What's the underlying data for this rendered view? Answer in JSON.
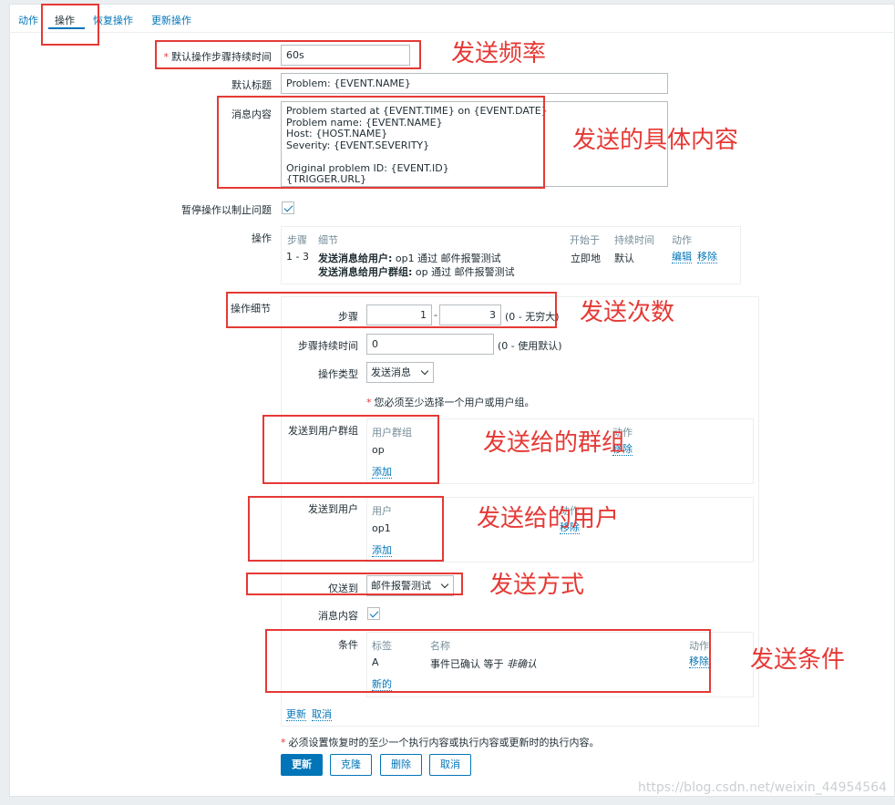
{
  "tabs": [
    {
      "label": "动作"
    },
    {
      "label": "操作"
    },
    {
      "label": "恢复操作"
    },
    {
      "label": "更新操作"
    }
  ],
  "form": {
    "default_step_duration": {
      "label": "默认操作步骤持续时间",
      "value": "60s"
    },
    "default_subject": {
      "label": "默认标题",
      "value": "Problem: {EVENT.NAME}"
    },
    "message": {
      "label": "消息内容",
      "value": "Problem started at {EVENT.TIME} on {EVENT.DATE}\nProblem name: {EVENT.NAME}\nHost: {HOST.NAME}\nSeverity: {EVENT.SEVERITY}\n\nOriginal problem ID: {EVENT.ID}\n{TRIGGER.URL}"
    },
    "pause_label": "暂停操作以制止问题",
    "operations_label": "操作"
  },
  "operations_table": {
    "headers": {
      "steps": "步骤",
      "details": "细节",
      "start_in": "开始于",
      "duration": "持续时间",
      "action": "动作"
    },
    "rows": [
      {
        "steps": "1 - 3",
        "detail1_bold": "发送消息给用户:",
        "detail1_rest": " op1 通过 邮件报警测试",
        "detail2_bold": "发送消息给用户群组:",
        "detail2_rest": " op 通过 邮件报警测试",
        "start_in": "立即地",
        "duration": "默认",
        "edit": "编辑",
        "remove": "移除"
      }
    ]
  },
  "op_details": {
    "title": "操作细节",
    "steps_label": "步骤",
    "step_from": "1",
    "step_dash": "-",
    "step_to": "3",
    "steps_hint": "(0 - 无穷大)",
    "step_duration_label": "步骤持续时间",
    "step_duration_value": "0",
    "step_duration_hint": "(0 - 使用默认)",
    "op_type_label": "操作类型",
    "op_type_value": "发送消息",
    "required_note": "您必须至少选择一个用户或用户组。",
    "user_groups": {
      "label": "发送到用户群组",
      "col": "用户群组",
      "action_col": "动作",
      "item": "op",
      "remove": "移除",
      "add": "添加"
    },
    "users": {
      "label": "发送到用户",
      "col": "用户",
      "action_col": "动作",
      "item": "op1",
      "remove": "移除",
      "add": "添加"
    },
    "send_only_label": "仅送到",
    "send_only_value": "邮件报警测试",
    "message_label": "消息内容",
    "conditions": {
      "label": "条件",
      "headers": {
        "tag": "标签",
        "name": "名称",
        "action": "动作"
      },
      "rows": [
        {
          "tag": "A",
          "name": "事件已确认 等于 ",
          "value": "非确认",
          "remove": "移除"
        }
      ],
      "new": "新的"
    },
    "update_link": "更新",
    "cancel_link": "取消"
  },
  "footer_note": "必须设置恢复时的至少一个执行内容或执行内容或更新时的执行内容。",
  "buttons": {
    "update": "更新",
    "clone": "克隆",
    "delete": "删除",
    "cancel": "取消"
  },
  "annotations": {
    "frequency": "发送频率",
    "content": "发送的具体内容",
    "count": "发送次数",
    "group": "发送给的群组",
    "user": "发送给的用户",
    "method": "发送方式",
    "condition": "发送条件"
  },
  "watermark": "https://blog.csdn.net/weixin_44954564",
  "colors": {
    "accent": "#0275b8",
    "annotation": "#e53935",
    "required": "#e33734"
  }
}
